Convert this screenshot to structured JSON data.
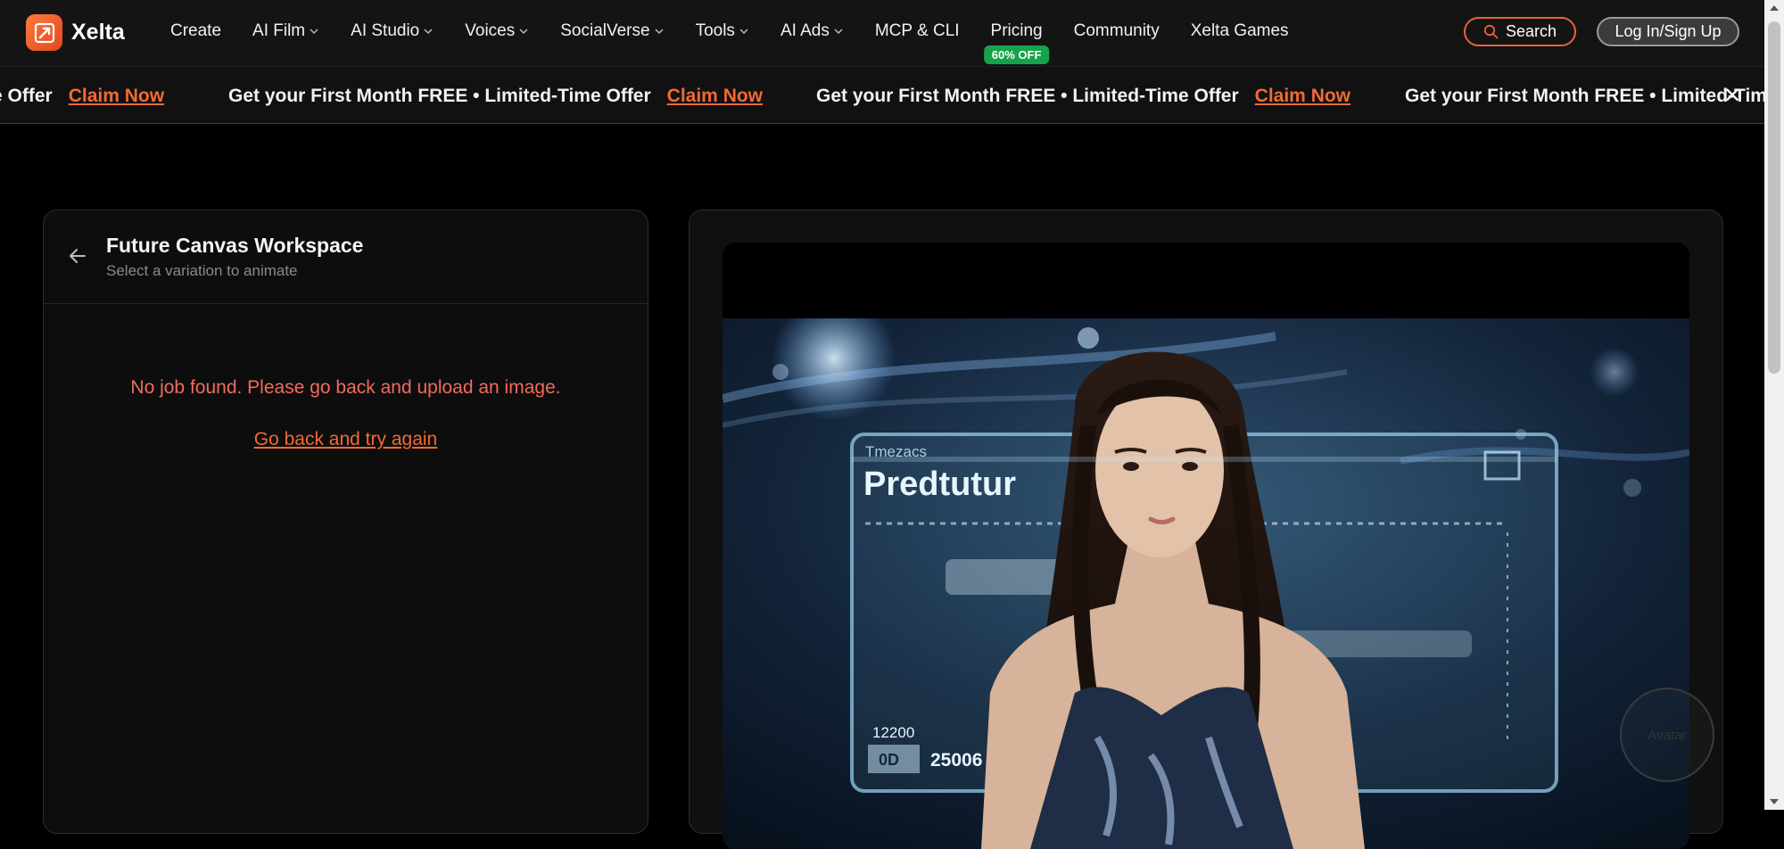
{
  "brand": {
    "name": "Xelta",
    "logo_icon": "xelta-logo-icon",
    "accent": "#e8643a"
  },
  "nav": {
    "items": [
      {
        "label": "Create",
        "dropdown": false
      },
      {
        "label": "AI Film",
        "dropdown": true
      },
      {
        "label": "AI Studio",
        "dropdown": true
      },
      {
        "label": "Voices",
        "dropdown": true
      },
      {
        "label": "SocialVerse",
        "dropdown": true
      },
      {
        "label": "Tools",
        "dropdown": true
      },
      {
        "label": "AI Ads",
        "dropdown": true
      },
      {
        "label": "MCP & CLI",
        "dropdown": false
      },
      {
        "label": "Pricing",
        "dropdown": false,
        "badge": "60% OFF"
      },
      {
        "label": "Community",
        "dropdown": false
      },
      {
        "label": "Xelta Games",
        "dropdown": false
      }
    ],
    "search_label": "Search",
    "login_label": "Log In/Sign Up"
  },
  "promo": {
    "segments": [
      {
        "text": "e Offer",
        "cta": "Claim Now"
      },
      {
        "text": "Get your First Month FREE • Limited-Time Offer",
        "cta": "Claim Now"
      },
      {
        "text": "Get your First Month FREE • Limited-Time Offer",
        "cta": "Claim Now"
      },
      {
        "text": "Get your First Month FREE • Limited-Time",
        "cta": ""
      }
    ],
    "close_icon": "close-icon",
    "close_glyph": "✕"
  },
  "workspace": {
    "title": "Future Canvas Workspace",
    "subtitle": "Select a variation to animate",
    "error": "No job found. Please go back and upload an image.",
    "retry_link": "Go back and try again"
  },
  "preview": {
    "image_icon": "portrait-hologram-image",
    "hud_title": "Predtutur",
    "hud_small": "Tmezacs",
    "hud_code": "12200",
    "hud_value": "25006",
    "hud_box": "0D",
    "fab_label": "Avatar"
  },
  "colors": {
    "bg": "#000000",
    "nav_bg": "#141414",
    "panel_bg": "#0d0d0d",
    "error": "#f26b5b",
    "badge": "#16a34a"
  }
}
